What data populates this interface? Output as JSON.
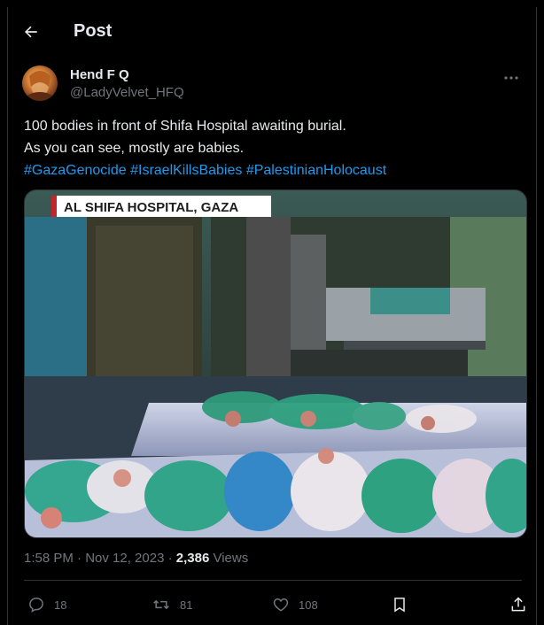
{
  "header": {
    "title": "Post"
  },
  "author": {
    "display_name": "Hend F Q",
    "handle": "@LadyVelvet_HFQ"
  },
  "post": {
    "line1": "100 bodies in front of Shifa Hospital awaiting burial.",
    "line2": "As you can see, mostly are babies.",
    "hashtags": [
      "#GazaGenocide",
      "#IsraelKillsBabies",
      "#PalestinianHolocaust"
    ],
    "media_caption": "AL SHIFA HOSPITAL, GAZA"
  },
  "meta": {
    "time_date": "1:58 PM · Nov 12, 2023 · ",
    "views_count": "2,386",
    "views_label": " Views"
  },
  "actions": {
    "replies": "18",
    "reposts": "81",
    "likes": "108"
  },
  "colors": {
    "background": "#000000",
    "text": "#e7e9ea",
    "secondary": "#71767b",
    "accent": "#1d9bf0",
    "border": "#2f3336"
  },
  "icons": [
    "back-arrow-icon",
    "more-dots-icon",
    "reply-icon",
    "repost-icon",
    "like-icon",
    "bookmark-icon",
    "share-icon"
  ]
}
